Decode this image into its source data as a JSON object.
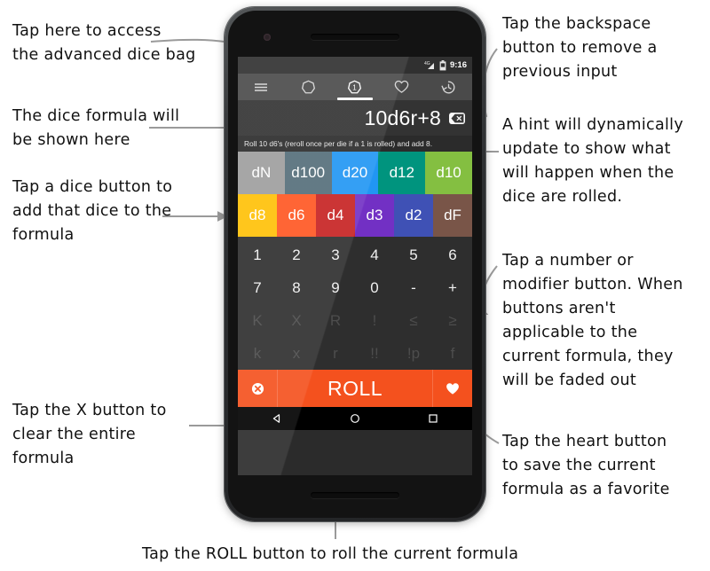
{
  "annotations": {
    "top_left": "Tap here to access\nthe advanced dice bag",
    "formula_left": "The dice formula will\nbe shown here",
    "dice_left": "Tap a dice button to\nadd that dice to the\nformula",
    "clear_left": "Tap the X button to\nclear the entire\nformula",
    "backspace_right": "Tap the backspace\nbutton to remove a\nprevious input",
    "hint_right": "A hint will dynamically\nupdate to show what\nwill happen when the\ndice are rolled.",
    "keypad_right": "Tap a number or\nmodifier button. When\nbuttons aren't\napplicable to the\ncurrent formula, they\nwill be faded out",
    "favorite_right": "Tap the heart button\nto save the current\nformula as a favorite",
    "bottom_caption": "Tap the ROLL button to roll the current formula"
  },
  "phone": {
    "statusbar": {
      "time": "9:16",
      "icons": [
        "signal-4g-icon",
        "battery-icon"
      ]
    },
    "appbar": {
      "tabs": [
        {
          "name": "menu",
          "icon": "hamburger-menu-icon",
          "active": false
        },
        {
          "name": "dice-bag",
          "icon": "heptagon-dice-icon",
          "active": false
        },
        {
          "name": "dice-roller",
          "icon": "numbered-die-icon",
          "active": true
        },
        {
          "name": "favorites",
          "icon": "heart-icon",
          "active": false
        },
        {
          "name": "history",
          "icon": "history-clock-icon",
          "active": false
        }
      ]
    },
    "formula": {
      "value": "10d6r+8",
      "backspace_icon": "backspace-icon",
      "hint": "Roll 10 d6's (reroll once per die if a 1 is rolled) and add 8."
    },
    "dice_row_1": [
      {
        "label": "dN",
        "color": "#9e9e9e"
      },
      {
        "label": "d100",
        "color": "#546e7a"
      },
      {
        "label": "d20",
        "color": "#2196f3"
      },
      {
        "label": "d12",
        "color": "#00947e"
      },
      {
        "label": "d10",
        "color": "#84bf41"
      }
    ],
    "dice_row_2": [
      {
        "label": "d8",
        "color": "#ffc107"
      },
      {
        "label": "d6",
        "color": "#ff5722"
      },
      {
        "label": "d4",
        "color": "#c62222"
      },
      {
        "label": "d3",
        "color": "#7230c4"
      },
      {
        "label": "d2",
        "color": "#3f51b5"
      },
      {
        "label": "dF",
        "color": "#795548"
      }
    ],
    "keypad": [
      {
        "keys": [
          "1",
          "2",
          "3",
          "4",
          "5",
          "6"
        ],
        "dim": false
      },
      {
        "keys": [
          "7",
          "8",
          "9",
          "0",
          "-",
          "+"
        ],
        "dim": false
      },
      {
        "keys": [
          "K",
          "X",
          "R",
          "!",
          "≤",
          "≥"
        ],
        "dim": true
      },
      {
        "keys": [
          "k",
          "x",
          "r",
          "!!",
          "!p",
          "f"
        ],
        "dim": true
      }
    ],
    "rollbar": {
      "clear_icon": "clear-x-circle-icon",
      "roll_label": "ROLL",
      "favorite_icon": "heart-filled-icon",
      "color": "#f4511e"
    },
    "navbar": {
      "keys": [
        "back-triangle-icon",
        "home-circle-icon",
        "recents-square-icon"
      ]
    }
  }
}
